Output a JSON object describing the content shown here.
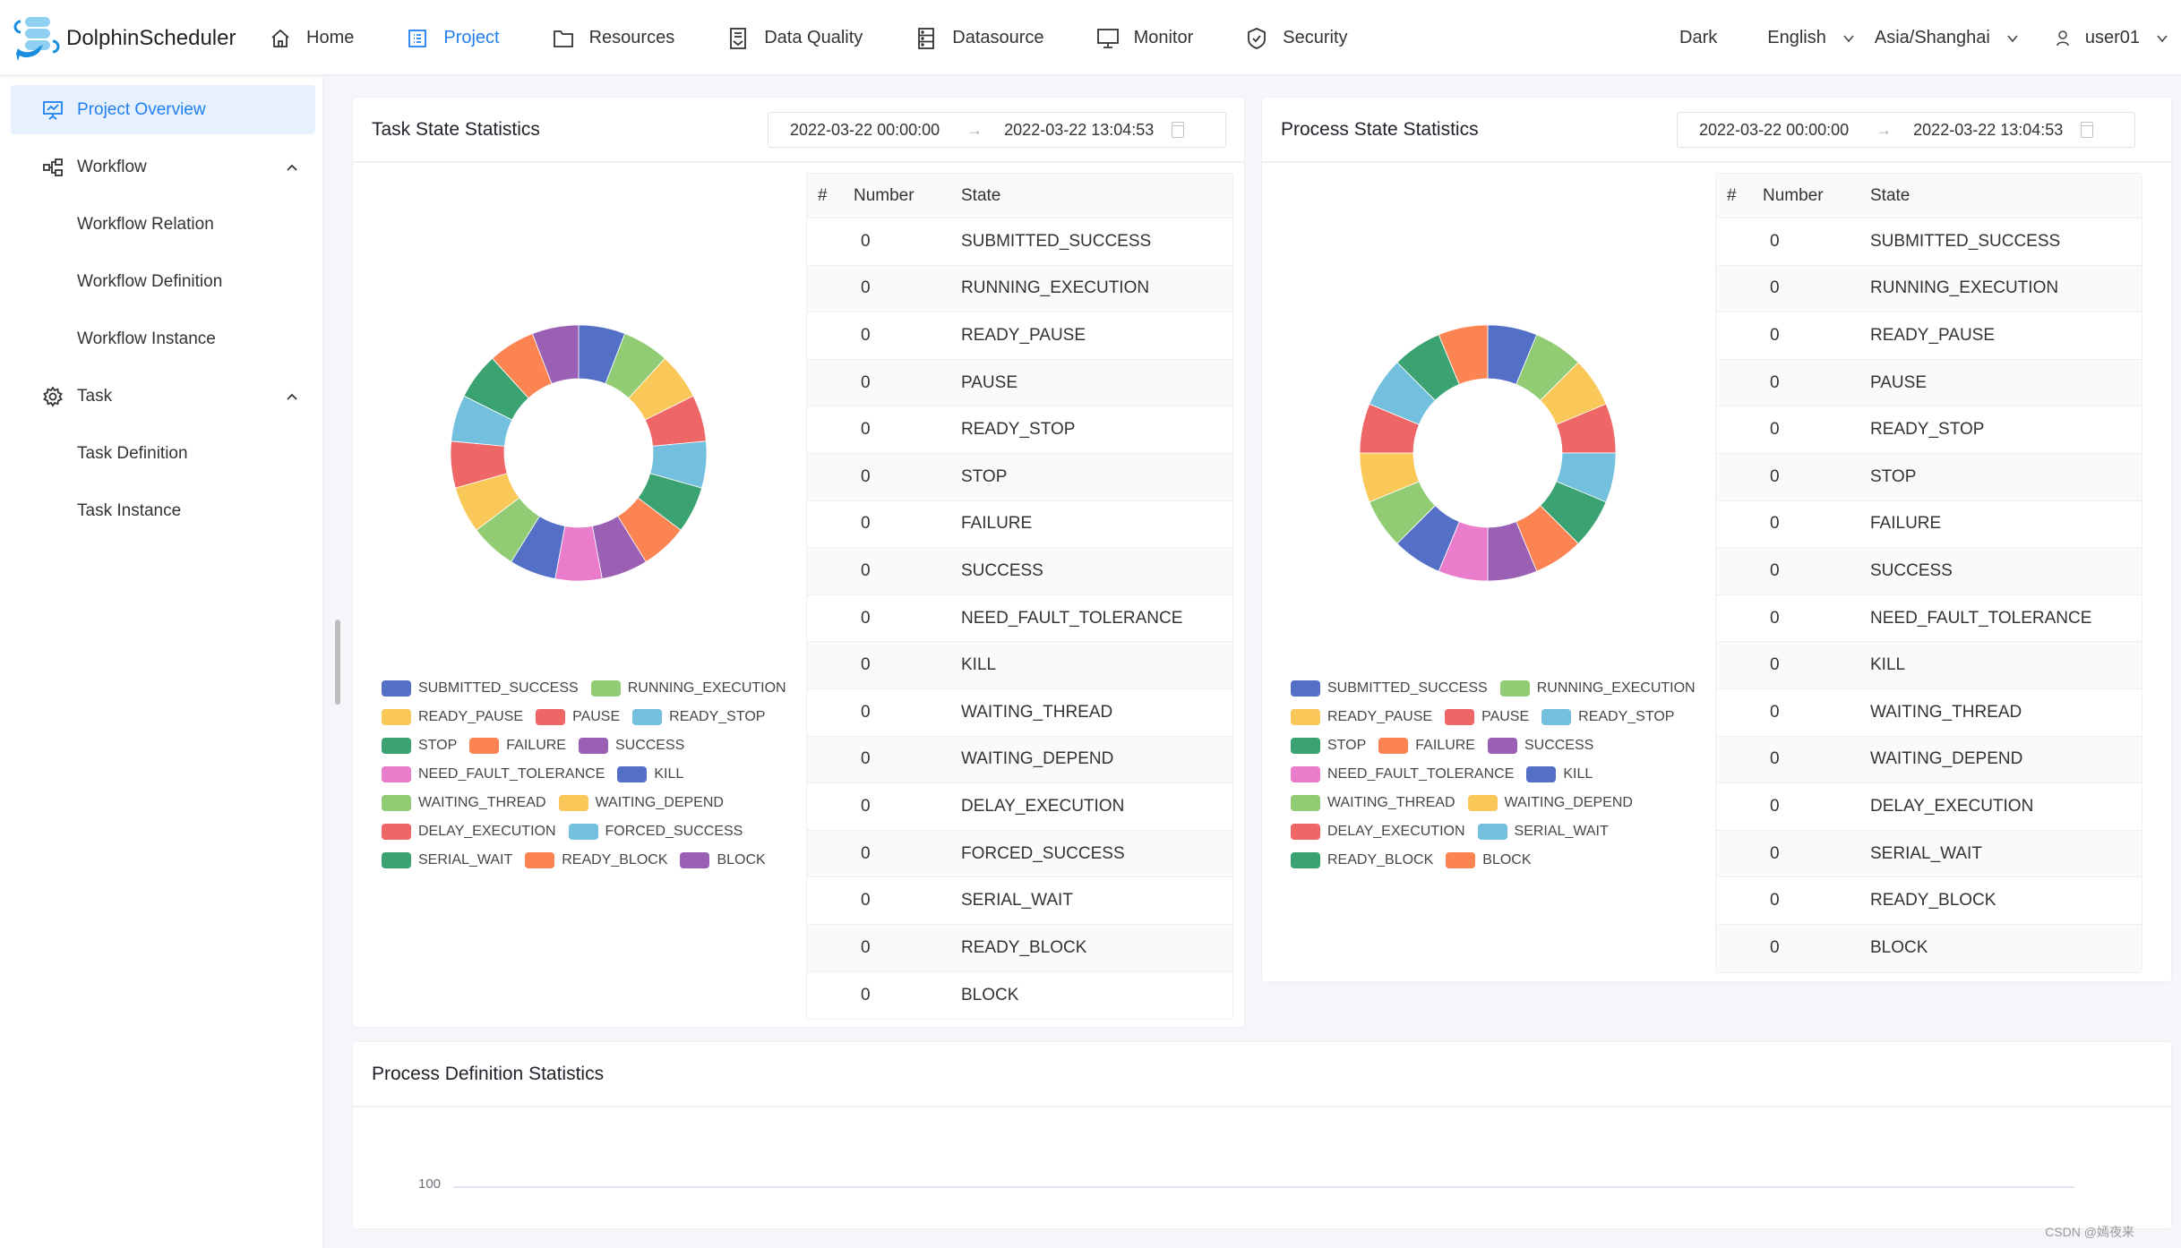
{
  "app": {
    "title": "DolphinScheduler"
  },
  "nav": {
    "items": [
      {
        "label": "Home",
        "icon": "home-icon"
      },
      {
        "label": "Project",
        "icon": "project-icon",
        "active": true
      },
      {
        "label": "Resources",
        "icon": "folder-icon"
      },
      {
        "label": "Data Quality",
        "icon": "data-quality-icon"
      },
      {
        "label": "Datasource",
        "icon": "datasource-icon"
      },
      {
        "label": "Monitor",
        "icon": "monitor-icon"
      },
      {
        "label": "Security",
        "icon": "shield-icon"
      }
    ],
    "theme": "Dark",
    "language": "English",
    "timezone": "Asia/Shanghai",
    "user": "user01"
  },
  "sidebar": {
    "items": [
      {
        "label": "Project Overview",
        "icon": "presentation-chart-icon",
        "active": true
      },
      {
        "label": "Workflow",
        "icon": "workflow-icon",
        "expandable": true
      },
      {
        "label": "Workflow Relation"
      },
      {
        "label": "Workflow Definition"
      },
      {
        "label": "Workflow Instance"
      },
      {
        "label": "Task",
        "icon": "gear-icon",
        "expandable": true
      },
      {
        "label": "Task Definition"
      },
      {
        "label": "Task Instance"
      }
    ]
  },
  "task_state": {
    "title": "Task State Statistics",
    "date_start": "2022-03-22 00:00:00",
    "date_end": "2022-03-22 13:04:53",
    "table_headers": [
      "#",
      "Number",
      "State"
    ]
  },
  "process_state": {
    "title": "Process State Statistics",
    "date_start": "2022-03-22 00:00:00",
    "date_end": "2022-03-22 13:04:53",
    "table_headers": [
      "#",
      "Number",
      "State"
    ]
  },
  "process_definition": {
    "title": "Process Definition Statistics",
    "y_tick": "100"
  },
  "palette": [
    "#5470c6",
    "#91cc75",
    "#fac858",
    "#ee6666",
    "#73c0de",
    "#3ba272",
    "#fc8452",
    "#9a60b4",
    "#ea7ccc"
  ],
  "watermark": "CSDN @嫣夜来",
  "chart_data": [
    {
      "type": "pie",
      "title": "Task State Statistics",
      "donut": true,
      "note": "all counts are 0; slices rendered equal",
      "categories": [
        "SUBMITTED_SUCCESS",
        "RUNNING_EXECUTION",
        "READY_PAUSE",
        "PAUSE",
        "READY_STOP",
        "STOP",
        "FAILURE",
        "SUCCESS",
        "NEED_FAULT_TOLERANCE",
        "KILL",
        "WAITING_THREAD",
        "WAITING_DEPEND",
        "DELAY_EXECUTION",
        "FORCED_SUCCESS",
        "SERIAL_WAIT",
        "READY_BLOCK",
        "BLOCK"
      ],
      "values": [
        0,
        0,
        0,
        0,
        0,
        0,
        0,
        0,
        0,
        0,
        0,
        0,
        0,
        0,
        0,
        0,
        0
      ],
      "legend": "bottom-left",
      "legend_rows": [
        [
          "SUBMITTED_SUCCESS",
          "RUNNING_EXECUTION"
        ],
        [
          "READY_PAUSE",
          "PAUSE",
          "READY_STOP"
        ],
        [
          "STOP",
          "FAILURE",
          "SUCCESS"
        ],
        [
          "NEED_FAULT_TOLERANCE",
          "KILL"
        ],
        [
          "WAITING_THREAD",
          "WAITING_DEPEND"
        ],
        [
          "DELAY_EXECUTION",
          "FORCED_SUCCESS"
        ],
        [
          "SERIAL_WAIT",
          "READY_BLOCK",
          "BLOCK"
        ]
      ]
    },
    {
      "type": "pie",
      "title": "Process State Statistics",
      "donut": true,
      "note": "all counts are 0; slices rendered equal",
      "categories": [
        "SUBMITTED_SUCCESS",
        "RUNNING_EXECUTION",
        "READY_PAUSE",
        "PAUSE",
        "READY_STOP",
        "STOP",
        "FAILURE",
        "SUCCESS",
        "NEED_FAULT_TOLERANCE",
        "KILL",
        "WAITING_THREAD",
        "WAITING_DEPEND",
        "DELAY_EXECUTION",
        "SERIAL_WAIT",
        "READY_BLOCK",
        "BLOCK"
      ],
      "values": [
        0,
        0,
        0,
        0,
        0,
        0,
        0,
        0,
        0,
        0,
        0,
        0,
        0,
        0,
        0,
        0
      ],
      "legend": "bottom-left",
      "legend_rows": [
        [
          "SUBMITTED_SUCCESS",
          "RUNNING_EXECUTION"
        ],
        [
          "READY_PAUSE",
          "PAUSE",
          "READY_STOP"
        ],
        [
          "STOP",
          "FAILURE",
          "SUCCESS"
        ],
        [
          "NEED_FAULT_TOLERANCE",
          "KILL"
        ],
        [
          "WAITING_THREAD",
          "WAITING_DEPEND"
        ],
        [
          "DELAY_EXECUTION",
          "SERIAL_WAIT"
        ],
        [
          "READY_BLOCK",
          "BLOCK"
        ]
      ]
    },
    {
      "type": "bar",
      "title": "Process Definition Statistics",
      "categories": [],
      "values": [],
      "yticks": [
        "100"
      ],
      "grid": true
    }
  ]
}
